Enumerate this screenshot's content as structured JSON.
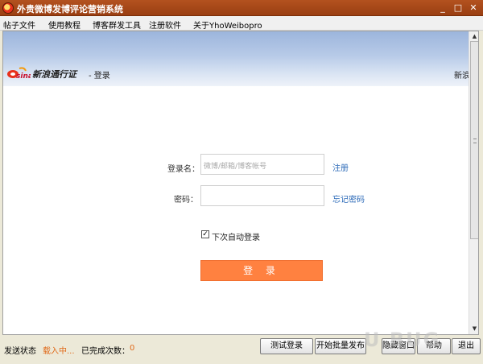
{
  "window": {
    "title": "外贵微博发博评论营销系统"
  },
  "menu": [
    "帖子文件",
    "使用教程",
    "博客群发工具",
    "注册软件",
    "关于YhoWeibopro"
  ],
  "banner": {
    "logo_text": "sina",
    "pass_title": "新浪通行证",
    "crumb": "- 登录",
    "right_text": "新浪"
  },
  "form": {
    "username_label": "登录名：",
    "username_placeholder": "微博/邮箱/博客帐号",
    "password_label": "密码：",
    "register_link": "注册",
    "forgot_link": "忘记密码",
    "auto_login_label": "下次自动登录",
    "auto_login_checked": true,
    "login_button": "登 录"
  },
  "status": {
    "send_label": "发送状态",
    "send_value": "载入中...",
    "count_label": "已完成次数：",
    "count_value": "0"
  },
  "buttons": {
    "test_login": "测试登录",
    "batch": "开始批量发布",
    "minimize": "隐藏窗口",
    "help": "帮助",
    "exit": "退出"
  },
  "watermark": "U BUG"
}
